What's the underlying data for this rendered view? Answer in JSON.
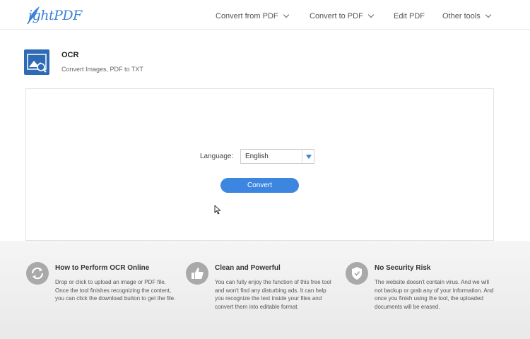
{
  "header": {
    "logo_text": "ightPDF",
    "nav": [
      {
        "label": "Convert from PDF",
        "has_dropdown": true
      },
      {
        "label": "Convert to PDF",
        "has_dropdown": true
      },
      {
        "label": "Edit PDF",
        "has_dropdown": false
      },
      {
        "label": "Other tools",
        "has_dropdown": true
      }
    ]
  },
  "tool": {
    "title": "OCR",
    "subtitle": "Convert Images, PDF to TXT",
    "icon": "image-search-icon"
  },
  "form": {
    "language_label": "Language:",
    "language_value": "English",
    "convert_label": "Convert"
  },
  "features": [
    {
      "icon": "refresh-icon",
      "title": "How to Perform OCR Online",
      "desc": "Drop or click to upload an image or PDF file. Once the tool finishes recognizing the content, you can click the download button to get the file."
    },
    {
      "icon": "thumbs-up-icon",
      "title": "Clean and Powerful",
      "desc": "You can fully enjoy the function of this free tool and won't find any disturbing ads. It can help you recognize the text inside your files and convert them into editable format."
    },
    {
      "icon": "shield-icon",
      "title": "No Security Risk",
      "desc": "The website doesn't contain virus. And we will not backup or grab any of your information. And once you finish using the tool, the uploaded documents will be erased."
    }
  ],
  "colors": {
    "brand": "#3b82d8",
    "button": "#3d86e0",
    "tool_icon_bg": "#2f6bb5"
  }
}
